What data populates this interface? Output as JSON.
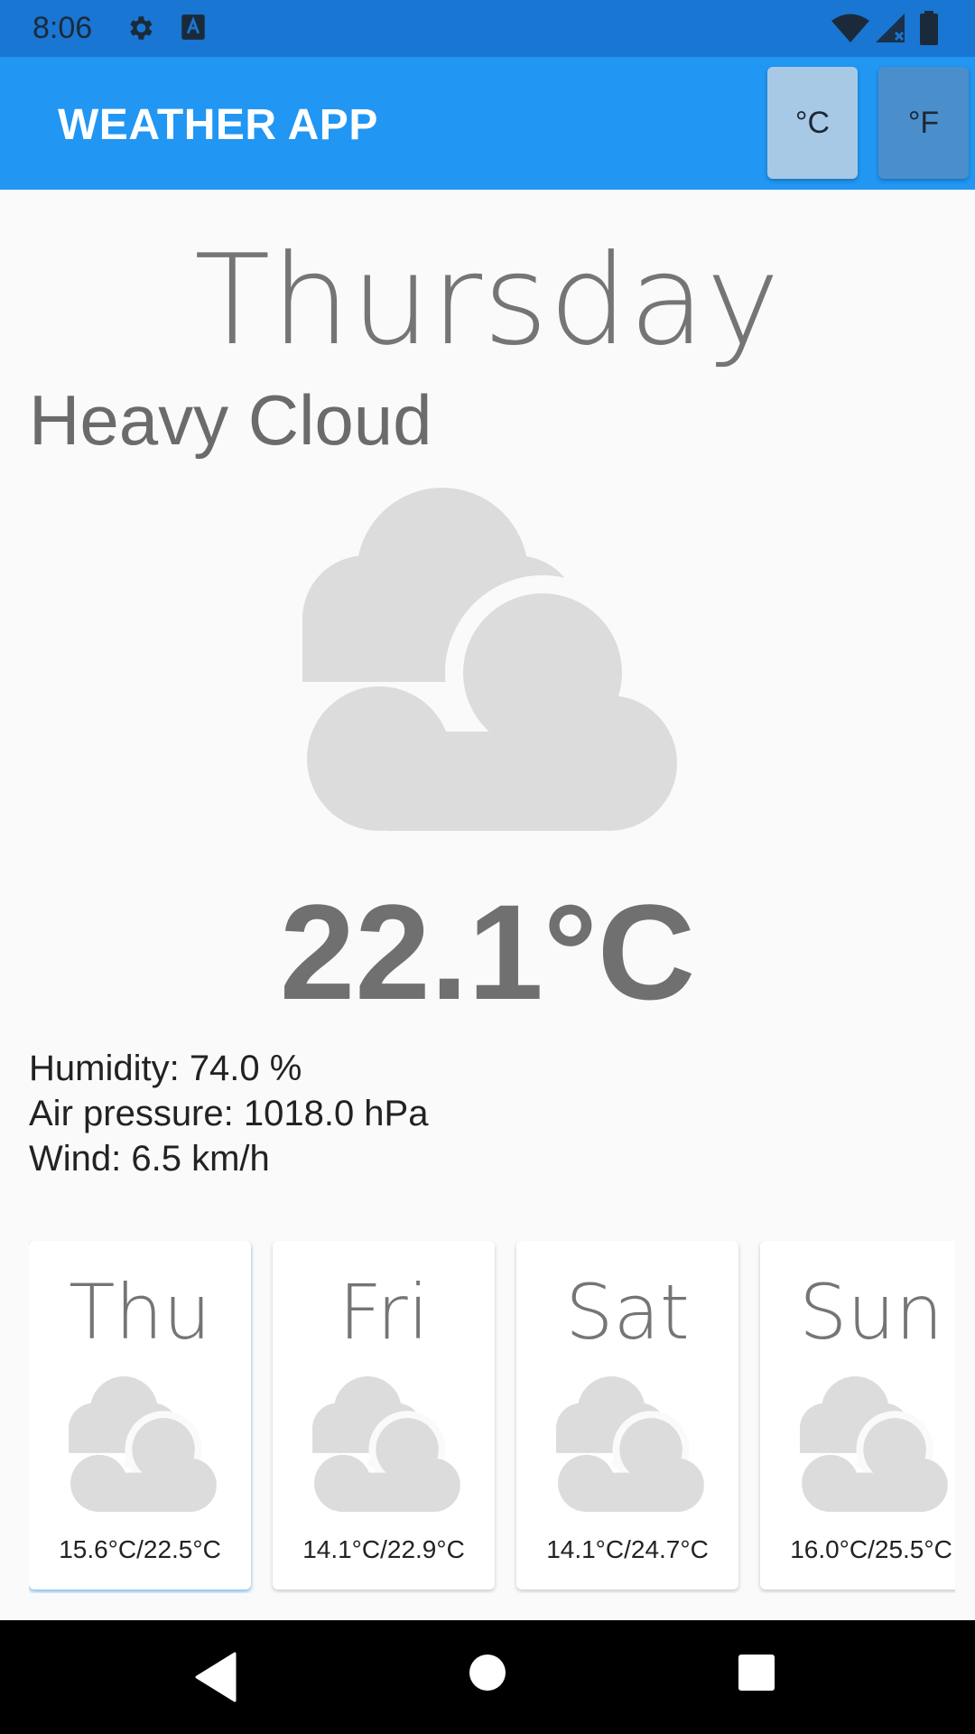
{
  "status_bar": {
    "time": "8:06",
    "icons": [
      "gear-icon",
      "font-a-icon",
      "wifi-icon",
      "signal-icon",
      "battery-icon"
    ]
  },
  "app_bar": {
    "title": "WEATHER APP",
    "units": [
      {
        "label": "°C",
        "selected": true
      },
      {
        "label": "°F",
        "selected": false
      }
    ]
  },
  "current": {
    "day": "Thursday",
    "condition": "Heavy Cloud",
    "icon": "heavy-cloud-icon",
    "temperature": "22.1°C",
    "humidity": "Humidity: 74.0 %",
    "air_pressure": "Air pressure: 1018.0 hPa",
    "wind": "Wind: 6.5 km/h"
  },
  "forecast": [
    {
      "day": "Thu",
      "icon": "heavy-cloud-icon",
      "range": "15.6°C/22.5°C",
      "selected": true
    },
    {
      "day": "Fri",
      "icon": "heavy-cloud-icon",
      "range": "14.1°C/22.9°C",
      "selected": false
    },
    {
      "day": "Sat",
      "icon": "heavy-cloud-icon",
      "range": "14.1°C/24.7°C",
      "selected": false
    },
    {
      "day": "Sun",
      "icon": "heavy-cloud-icon",
      "range": "16.0°C/25.5°C",
      "selected": false
    }
  ],
  "colors": {
    "status_bar": "#1976d2",
    "app_bar": "#2196f3",
    "cloud": "#dcdcdc",
    "text_grey": "#757575"
  }
}
